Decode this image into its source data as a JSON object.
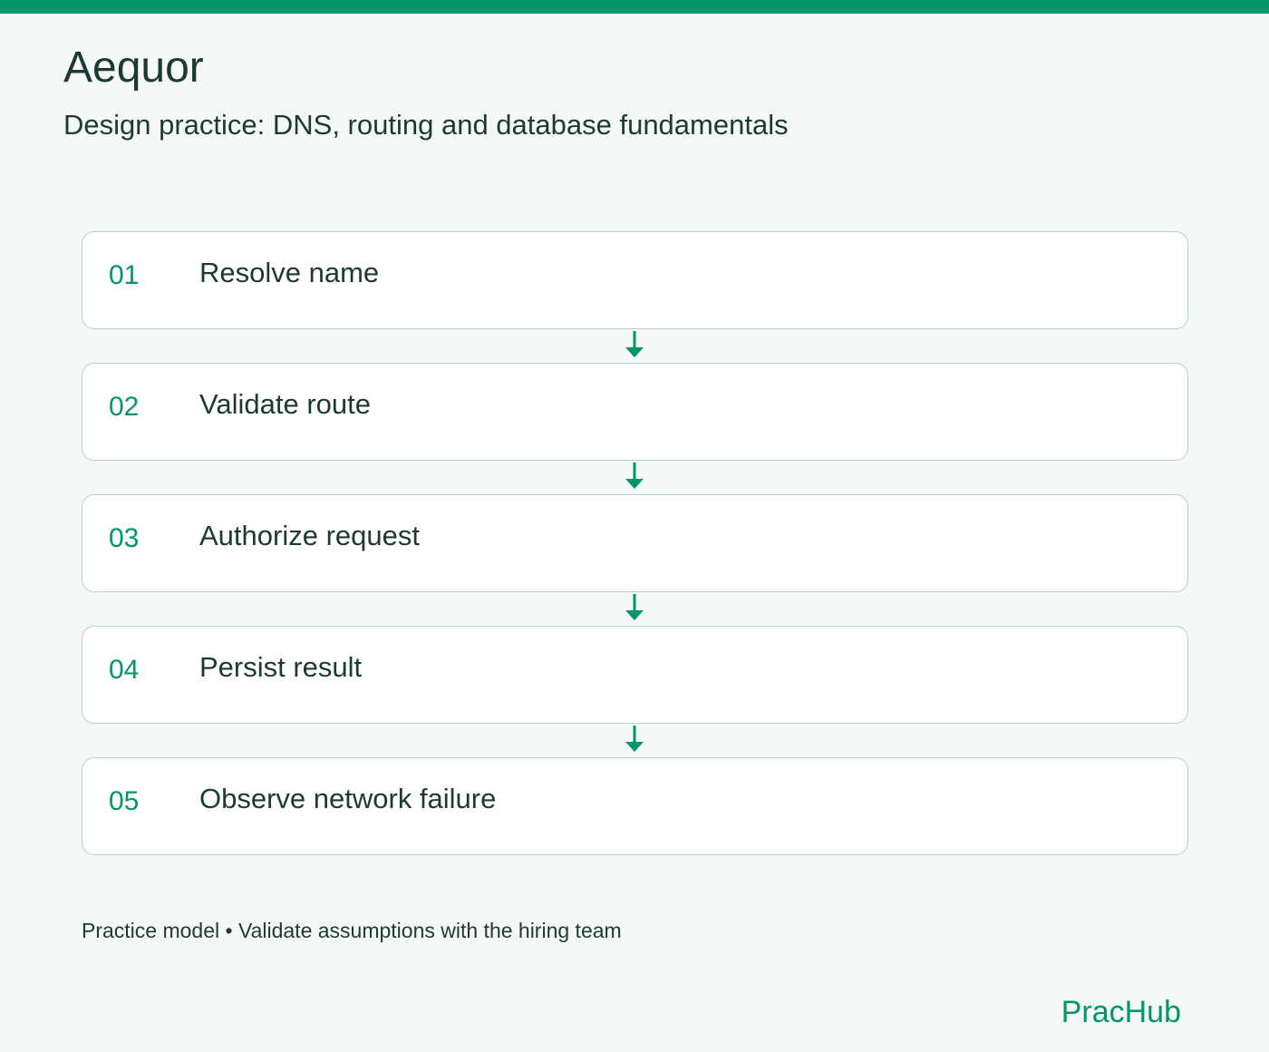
{
  "header": {
    "title": "Aequor",
    "subtitle": "Design practice: DNS, routing and database fundamentals"
  },
  "steps": [
    {
      "number": "01",
      "label": "Resolve name"
    },
    {
      "number": "02",
      "label": "Validate route"
    },
    {
      "number": "03",
      "label": "Authorize request"
    },
    {
      "number": "04",
      "label": "Persist result"
    },
    {
      "number": "05",
      "label": "Observe network failure"
    }
  ],
  "footer": {
    "note": "Practice model • Validate assumptions with the hiring team",
    "brand": "PracHub"
  },
  "colors": {
    "accent": "#04966b",
    "text": "#1c3a33",
    "background": "#f4f8f6",
    "card_border": "#b5d6cb"
  },
  "icons": {
    "connector": "arrow-down-icon"
  }
}
